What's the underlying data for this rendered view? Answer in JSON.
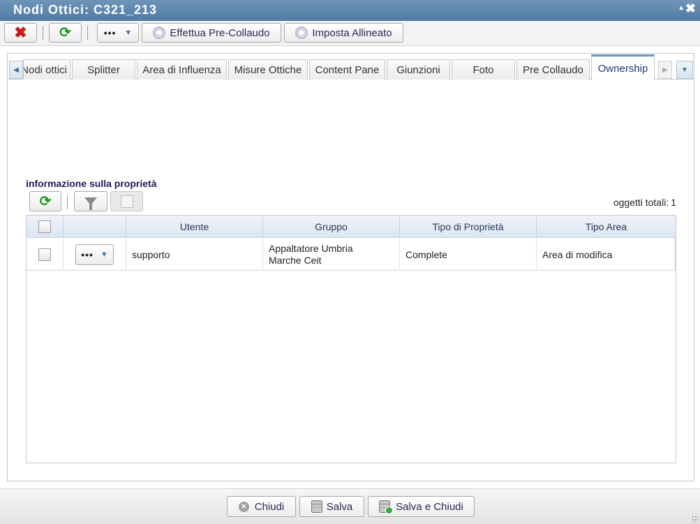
{
  "window": {
    "title": "Nodi Ottici: C321_213",
    "collapse_icon": "▲",
    "close_icon": "✖"
  },
  "toolbar": {
    "close_icon": "✖",
    "refresh_icon": "⟳",
    "more_label": "•••",
    "more_caret": "▼",
    "precollaudo_label": "Effettua Pre-Collaudo",
    "allineato_label": "Imposta Allineato"
  },
  "tabs": {
    "items": [
      {
        "label": "Nodi ottici"
      },
      {
        "label": "Splitter"
      },
      {
        "label": "Area di Influenza"
      },
      {
        "label": "Misure Ottiche"
      },
      {
        "label": "Content Pane"
      },
      {
        "label": "Giunzioni"
      },
      {
        "label": "Foto"
      },
      {
        "label": "Pre Collaudo"
      },
      {
        "label": "Ownership"
      }
    ],
    "active": "Ownership",
    "scroll_left": "◀",
    "scroll_right": "▶",
    "menu": "▼"
  },
  "section": {
    "title": "informazione sulla proprietà"
  },
  "grid_toolbar": {
    "refresh_icon": "⟳",
    "total_label": "oggetti totali:",
    "total_value": "1"
  },
  "grid": {
    "columns": [
      "Utente",
      "Gruppo",
      "Tipo di Proprietà",
      "Tipo Area"
    ],
    "rows": [
      {
        "menu_label": "•••",
        "menu_caret": "▼",
        "utente": "supporto",
        "gruppo": "Appaltatore Umbria Marche Ceit",
        "tipo_proprieta": "Complete",
        "tipo_area": "Area di modifica"
      }
    ]
  },
  "footer": {
    "chiudi_label": "Chiudi",
    "salva_label": "Salva",
    "salva_chiudi_label": "Salva e Chiudi"
  },
  "colors": {
    "titlebar": "#5a82aa",
    "accent": "#6a94ba",
    "refresh_green": "#1e9a1e",
    "close_red": "#d01818"
  }
}
